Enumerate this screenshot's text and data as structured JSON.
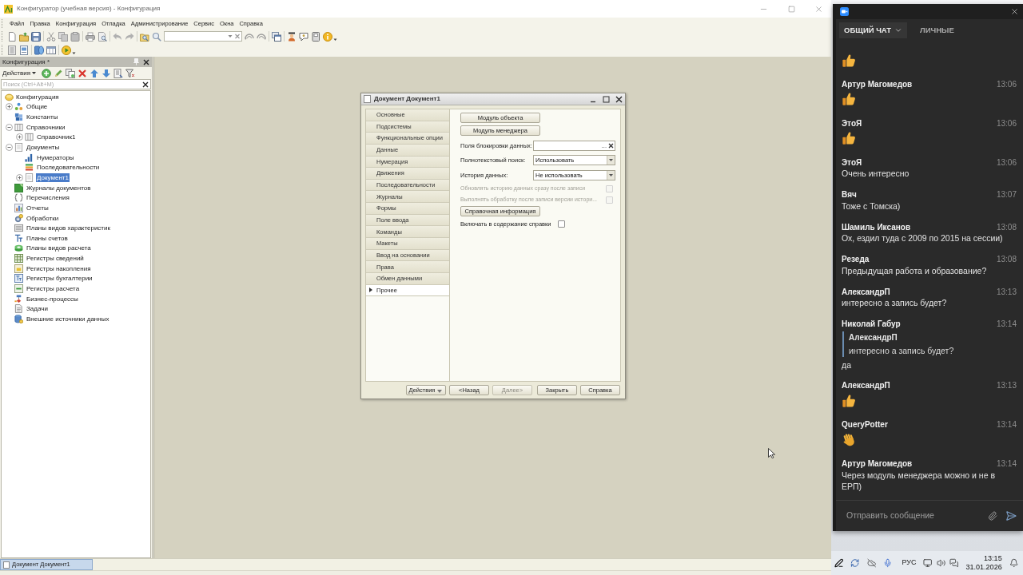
{
  "window": {
    "title": "Конфигуратор (учебная версия) - Конфигурация"
  },
  "menu": [
    {
      "label": "Файл"
    },
    {
      "label": "Правка"
    },
    {
      "label": "Конфигурация"
    },
    {
      "label": "Отладка"
    },
    {
      "label": "Администрирование"
    },
    {
      "label": "Сервис"
    },
    {
      "label": "Окна"
    },
    {
      "label": "Справка"
    }
  ],
  "config_panel": {
    "title": "Конфигурация *",
    "actions_label": "Действия",
    "search": {
      "placeholder": "Поиск (Ctrl+Alt+M)"
    },
    "tree": [
      {
        "label": "Конфигурация",
        "kind": "root",
        "selected": false,
        "children": [
          {
            "label": "Общие",
            "kind": "common",
            "selected": false,
            "expanded": false
          },
          {
            "label": "Константы",
            "kind": "constants",
            "selected": false
          },
          {
            "label": "Справочники",
            "kind": "catalogs",
            "selected": false,
            "expanded": true,
            "children": [
              {
                "label": "Справочник1",
                "kind": "catalog",
                "selected": false,
                "expanded": false
              }
            ]
          },
          {
            "label": "Документы",
            "kind": "documents",
            "selected": false,
            "expanded": true,
            "children": [
              {
                "label": "Нумераторы",
                "kind": "numerators",
                "selected": false
              },
              {
                "label": "Последовательности",
                "kind": "sequences",
                "selected": false
              },
              {
                "label": "Документ1",
                "kind": "document",
                "selected": true,
                "expanded": false
              }
            ]
          },
          {
            "label": "Журналы документов",
            "kind": "journals",
            "selected": false
          },
          {
            "label": "Перечисления",
            "kind": "enums",
            "selected": false
          },
          {
            "label": "Отчеты",
            "kind": "reports",
            "selected": false
          },
          {
            "label": "Обработки",
            "kind": "processors",
            "selected": false
          },
          {
            "label": "Планы видов характеристик",
            "kind": "char-plans",
            "selected": false
          },
          {
            "label": "Планы счетов",
            "kind": "account-plans",
            "selected": false
          },
          {
            "label": "Планы видов расчета",
            "kind": "calc-plans",
            "selected": false
          },
          {
            "label": "Регистры сведений",
            "kind": "info-registers",
            "selected": false
          },
          {
            "label": "Регистры накопления",
            "kind": "accum-registers",
            "selected": false
          },
          {
            "label": "Регистры бухгалтерии",
            "kind": "accounting-registers",
            "selected": false
          },
          {
            "label": "Регистры расчета",
            "kind": "calc-registers",
            "selected": false
          },
          {
            "label": "Бизнес-процессы",
            "kind": "business-processes",
            "selected": false
          },
          {
            "label": "Задачи",
            "kind": "tasks",
            "selected": false
          },
          {
            "label": "Внешние источники данных",
            "kind": "external-sources",
            "selected": false
          }
        ]
      }
    ]
  },
  "dialog": {
    "title": "Документ Документ1",
    "tabs": [
      {
        "label": "Основные",
        "selected": false
      },
      {
        "label": "Подсистемы",
        "selected": false
      },
      {
        "label": "Функциональные опции",
        "selected": false
      },
      {
        "label": "Данные",
        "selected": false
      },
      {
        "label": "Нумерация",
        "selected": false
      },
      {
        "label": "Движения",
        "selected": false
      },
      {
        "label": "Последовательности",
        "selected": false
      },
      {
        "label": "Журналы",
        "selected": false
      },
      {
        "label": "Формы",
        "selected": false
      },
      {
        "label": "Поле ввода",
        "selected": false
      },
      {
        "label": "Команды",
        "selected": false
      },
      {
        "label": "Макеты",
        "selected": false
      },
      {
        "label": "Ввод на основании",
        "selected": false
      },
      {
        "label": "Права",
        "selected": false
      },
      {
        "label": "Обмен данными",
        "selected": false
      },
      {
        "label": "Прочее",
        "selected": true
      }
    ],
    "content": [
      {
        "kind": "button",
        "label": "Модуль объекта"
      },
      {
        "kind": "button",
        "label": "Модуль менеджера"
      },
      {
        "kind": "input",
        "label": "Поля блокировки данных:",
        "choice_button": "..."
      },
      {
        "kind": "select",
        "label": "Полнотекстовый поиск:",
        "value": "Использовать"
      },
      {
        "kind": "select",
        "label": "История данных:",
        "value": "Не использовать"
      },
      {
        "kind": "aligned-checkbox",
        "label": "Обновлять историю данных сразу после записи",
        "checked": false,
        "disabled": true
      },
      {
        "kind": "aligned-checkbox",
        "label": "Выполнять обработку после записи версии истори...",
        "checked": false,
        "disabled": true
      },
      {
        "kind": "button",
        "label": "Справочная информация"
      },
      {
        "kind": "checkbox",
        "label": "Включать в содержание справки",
        "checked": false,
        "disabled": false
      }
    ],
    "footer": [
      {
        "kind": "menu",
        "label": "Действия",
        "disabled": false
      },
      {
        "kind": "button",
        "label": "<Назад",
        "disabled": false
      },
      {
        "kind": "button",
        "label": "Далее>",
        "disabled": true
      },
      {
        "kind": "button",
        "label": "Закрыть",
        "disabled": false
      },
      {
        "kind": "button",
        "label": "Справка",
        "disabled": false
      }
    ]
  },
  "window_tabs": [
    {
      "label": "Документ Документ1",
      "selected": true
    }
  ],
  "chat": {
    "tabs": [
      {
        "label": "ОБЩИЙ ЧАТ",
        "selected": true,
        "dropdown": true
      },
      {
        "label": "ЛИЧНЫЕ",
        "selected": false,
        "dropdown": false
      }
    ],
    "messages": [
      {
        "kind": "thumbs-up"
      },
      {
        "kind": "thumbs-up",
        "author": "Артур Магомедов",
        "time": "13:06"
      },
      {
        "kind": "thumbs-up",
        "author": "ЭтоЯ",
        "time": "13:06"
      },
      {
        "kind": "text",
        "author": "ЭтоЯ",
        "time": "13:06",
        "text": "Очень интересно"
      },
      {
        "kind": "text",
        "author": "Вяч",
        "time": "13:07",
        "text": "Тоже с Томска)"
      },
      {
        "kind": "text",
        "author": "Шамиль Иксанов",
        "time": "13:08",
        "text": "Ох, ездил туда с 2009 по 2015 на сессии)"
      },
      {
        "kind": "text",
        "author": "Резеда",
        "time": "13:08",
        "text": "Предыдущая работа и образование?"
      },
      {
        "kind": "text",
        "author": "АлександрП",
        "time": "13:13",
        "text": "интересно а запись будет?"
      },
      {
        "kind": "reply",
        "author": "Николай Габур",
        "time": "13:14",
        "quote": {
          "author": "АлександрП",
          "text": "интересно а запись будет?"
        },
        "text": "да"
      },
      {
        "kind": "thumbs-up",
        "author": "АлександрП",
        "time": "13:13"
      },
      {
        "kind": "wave",
        "author": "QueryPotter",
        "time": "13:14"
      },
      {
        "kind": "text",
        "author": "Артур Магомедов",
        "time": "13:14",
        "text": "Через модуль менеджера можно и не в ЕРП)"
      }
    ],
    "composer": {
      "placeholder": "Отправить сообщение"
    }
  },
  "taskbar": {
    "language": "РУС",
    "time": "13:15",
    "date": "31.01.2026"
  }
}
